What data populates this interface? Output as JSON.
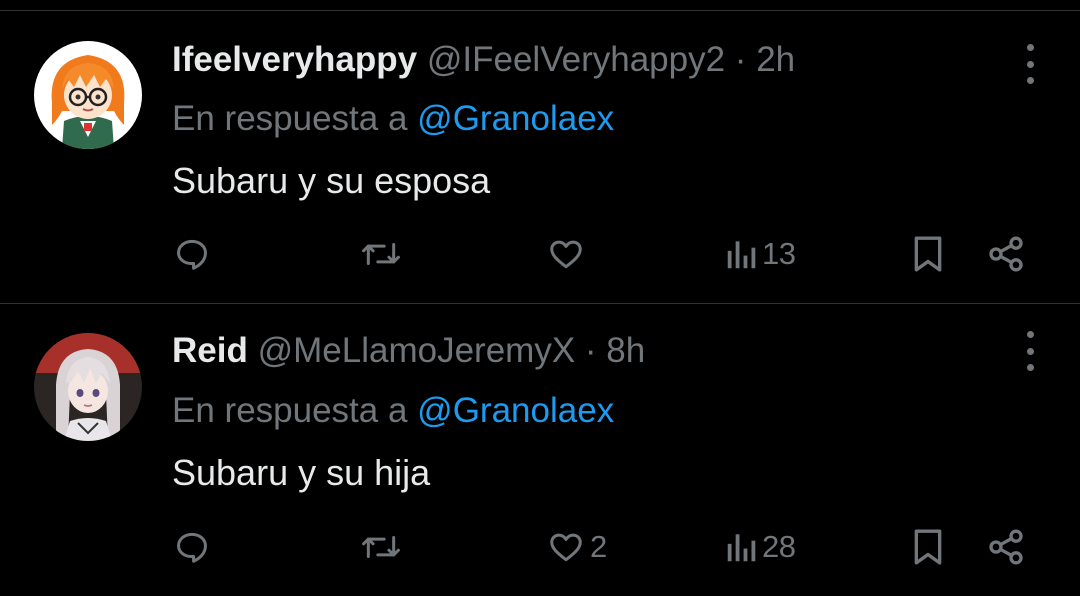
{
  "tweets": [
    {
      "display_name": "Ifeelveryhappy",
      "handle": "@IFeelVeryhappy2",
      "separator": "·",
      "time": "2h",
      "reply_prefix": "En respuesta a",
      "reply_to": "@Granolaex",
      "text": "Subaru y su esposa",
      "likes": "",
      "views": "13",
      "avatar_icon": "orange-hair-glasses-avatar"
    },
    {
      "display_name": "Reid",
      "handle": "@MeLlamoJeremyX",
      "separator": "·",
      "time": "8h",
      "reply_prefix": "En respuesta a",
      "reply_to": "@Granolaex",
      "text": "Subaru y su hija",
      "likes": "2",
      "views": "28",
      "avatar_icon": "silver-hair-girl-avatar"
    }
  ],
  "icons": {
    "reply": "comment-icon",
    "retweet": "retweet-icon",
    "like": "heart-icon",
    "views": "analytics-icon",
    "bookmark": "bookmark-icon",
    "share": "share-icon",
    "more": "more-dots-icon"
  },
  "colors": {
    "background": "#000000",
    "text": "#e7e9ea",
    "muted": "#71767b",
    "mention": "#1d9bf0",
    "divider": "#2f3336"
  }
}
